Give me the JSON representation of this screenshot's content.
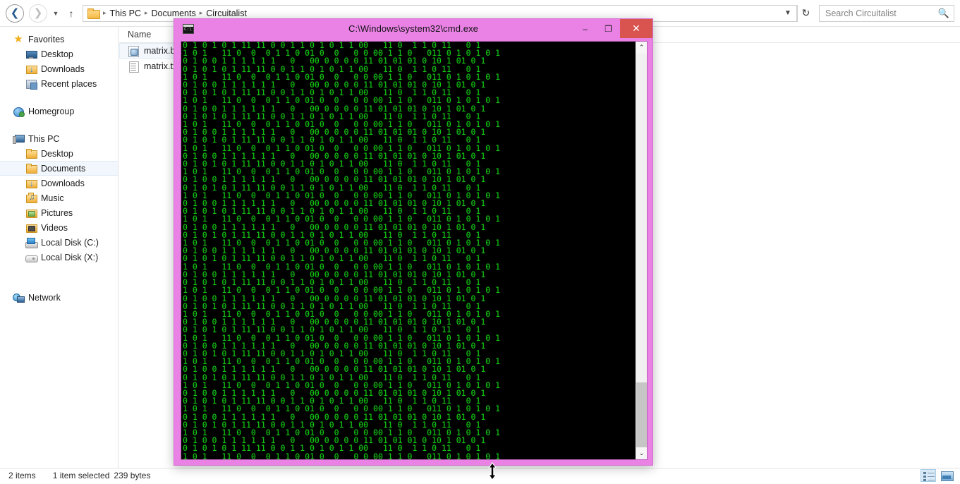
{
  "explorer": {
    "nav": {
      "back_icon": "back-arrow-icon",
      "forward_icon": "forward-arrow-icon",
      "history_icon": "chevron-down-icon",
      "up_icon": "up-arrow-icon",
      "breadcrumb": [
        "This PC",
        "Documents",
        "Circuitalist"
      ],
      "breadcrumb_separator": "▸",
      "address_chevron": "⌄",
      "refresh_icon": "↻"
    },
    "search": {
      "placeholder": "Search Circuitalist",
      "value": "",
      "icon": "search-icon"
    },
    "sidebar": [
      {
        "label": "Favorites",
        "icon": "star-icon",
        "level": 0,
        "selected": false
      },
      {
        "label": "Desktop",
        "icon": "monitor-icon",
        "level": 1,
        "selected": false
      },
      {
        "label": "Downloads",
        "icon": "downloads-folder-icon",
        "level": 1,
        "selected": false
      },
      {
        "label": "Recent places",
        "icon": "recent-places-icon",
        "level": 1,
        "selected": false
      },
      {
        "label": "Homegroup",
        "icon": "homegroup-icon",
        "level": 0,
        "selected": false
      },
      {
        "label": "This PC",
        "icon": "this-pc-icon",
        "level": 0,
        "selected": false
      },
      {
        "label": "Desktop",
        "icon": "desktop-folder-icon",
        "level": 1,
        "selected": false
      },
      {
        "label": "Documents",
        "icon": "documents-folder-icon",
        "level": 1,
        "selected": true
      },
      {
        "label": "Downloads",
        "icon": "downloads-folder-icon",
        "level": 1,
        "selected": false
      },
      {
        "label": "Music",
        "icon": "music-folder-icon",
        "level": 1,
        "selected": false
      },
      {
        "label": "Pictures",
        "icon": "pictures-folder-icon",
        "level": 1,
        "selected": false
      },
      {
        "label": "Videos",
        "icon": "videos-folder-icon",
        "level": 1,
        "selected": false
      },
      {
        "label": "Local Disk (C:)",
        "icon": "local-disk-icon",
        "level": 1,
        "selected": false
      },
      {
        "label": "Local Disk (X:)",
        "icon": "removable-disk-icon",
        "level": 1,
        "selected": false
      },
      {
        "label": "Network",
        "icon": "network-icon",
        "level": 0,
        "selected": false
      }
    ],
    "columns": {
      "name": "Name"
    },
    "files": [
      {
        "name": "matrix.bat",
        "icon": "bat-file-icon",
        "selected": true
      },
      {
        "name": "matrix.txt",
        "icon": "txt-file-icon",
        "selected": false
      }
    ],
    "status": {
      "item_count": "2 items",
      "selection": "1 item selected",
      "size": "239 bytes",
      "view_details_icon": "details-view-icon",
      "view_large_icon": "large-icons-view-icon"
    }
  },
  "cmd": {
    "title": "C:\\Windows\\system32\\cmd.exe",
    "icon": "cmd-window-icon",
    "minimize_label": "–",
    "maximize_label": "❐",
    "close_label": "✕",
    "titlebar_color": "#ea82e6",
    "close_button_color": "#d9534f",
    "text_color": "#13c413",
    "background_color": "#000000",
    "scroll_up_icon": "⌃",
    "scroll_down_icon": "⌄",
    "output_lines": [
      "0 1 0 1 0 1 11 11 0 0 1 1 0 1 0 1 1 00   11 0  1 1 0 11   0 1",
      "1 0 1   11 0  0  0 1 1 0 01 0  0   0 0 00 1 1 0   011 0 1 0 1 0 1",
      "0 1 0 0 1 1 1 1 1 1   0   00 0 0 0 0 11 01 01 01 0 10 1 01 0 1"
    ],
    "line_repeat_count": 53
  },
  "cursor": {
    "type": "vertical-resize-cursor"
  }
}
